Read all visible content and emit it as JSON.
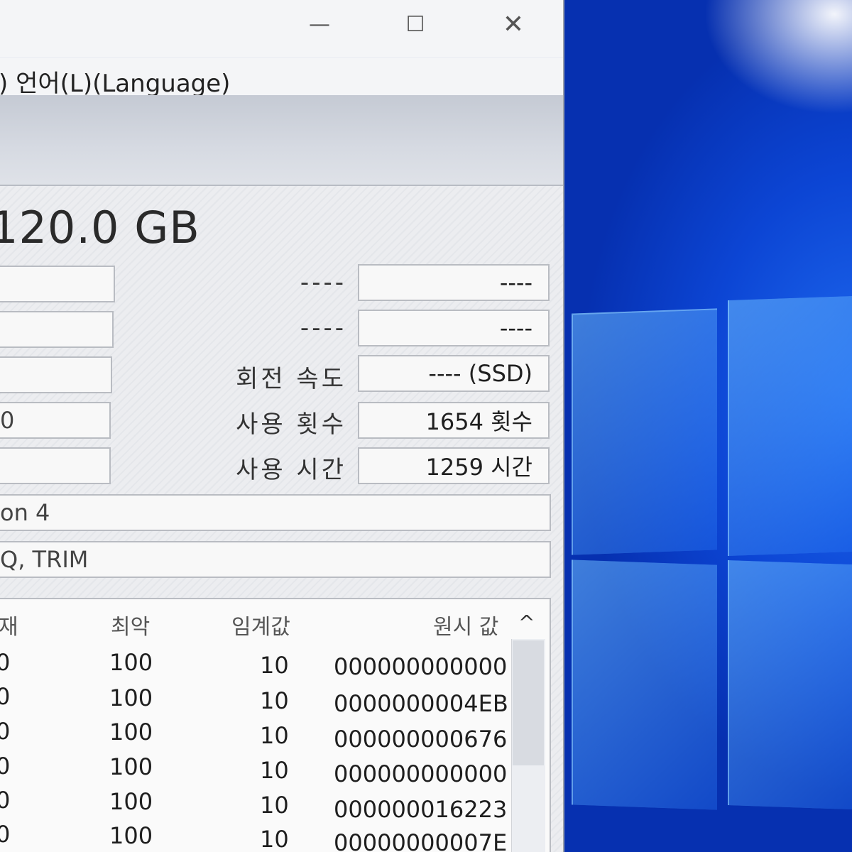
{
  "window": {
    "controls": {
      "minimize": "—",
      "maximize": "☐",
      "close": "✕"
    },
    "menu": {
      "language": ")   언어(L)(Language)"
    }
  },
  "disk": {
    "capacity": "120.0 GB",
    "left_fields": [
      "",
      "",
      "",
      "0",
      ""
    ],
    "right": [
      {
        "label": "----",
        "value": "----"
      },
      {
        "label": "----",
        "value": "----"
      },
      {
        "label": "회전 속도",
        "value": "---- (SSD)"
      },
      {
        "label": "사용 횟수",
        "value": "1654 횟수"
      },
      {
        "label": "사용 시간",
        "value": "1259 시간"
      }
    ],
    "standard": "on 4",
    "features": "Q, TRIM"
  },
  "smart": {
    "headers": {
      "current": "재",
      "worst": "최악",
      "threshold": "임계값",
      "raw": "원시 값"
    },
    "rows": [
      {
        "current": "0",
        "worst": "100",
        "threshold": "10",
        "raw": "000000000000"
      },
      {
        "current": "0",
        "worst": "100",
        "threshold": "10",
        "raw": "0000000004EB"
      },
      {
        "current": "0",
        "worst": "100",
        "threshold": "10",
        "raw": "000000000676"
      },
      {
        "current": "0",
        "worst": "100",
        "threshold": "10",
        "raw": "000000000000"
      },
      {
        "current": "0",
        "worst": "100",
        "threshold": "10",
        "raw": "000000016223"
      },
      {
        "current": "0",
        "worst": "100",
        "threshold": "10",
        "raw": "00000000007E"
      }
    ]
  },
  "icons": {
    "scroll_up": "chevron-up-icon"
  }
}
